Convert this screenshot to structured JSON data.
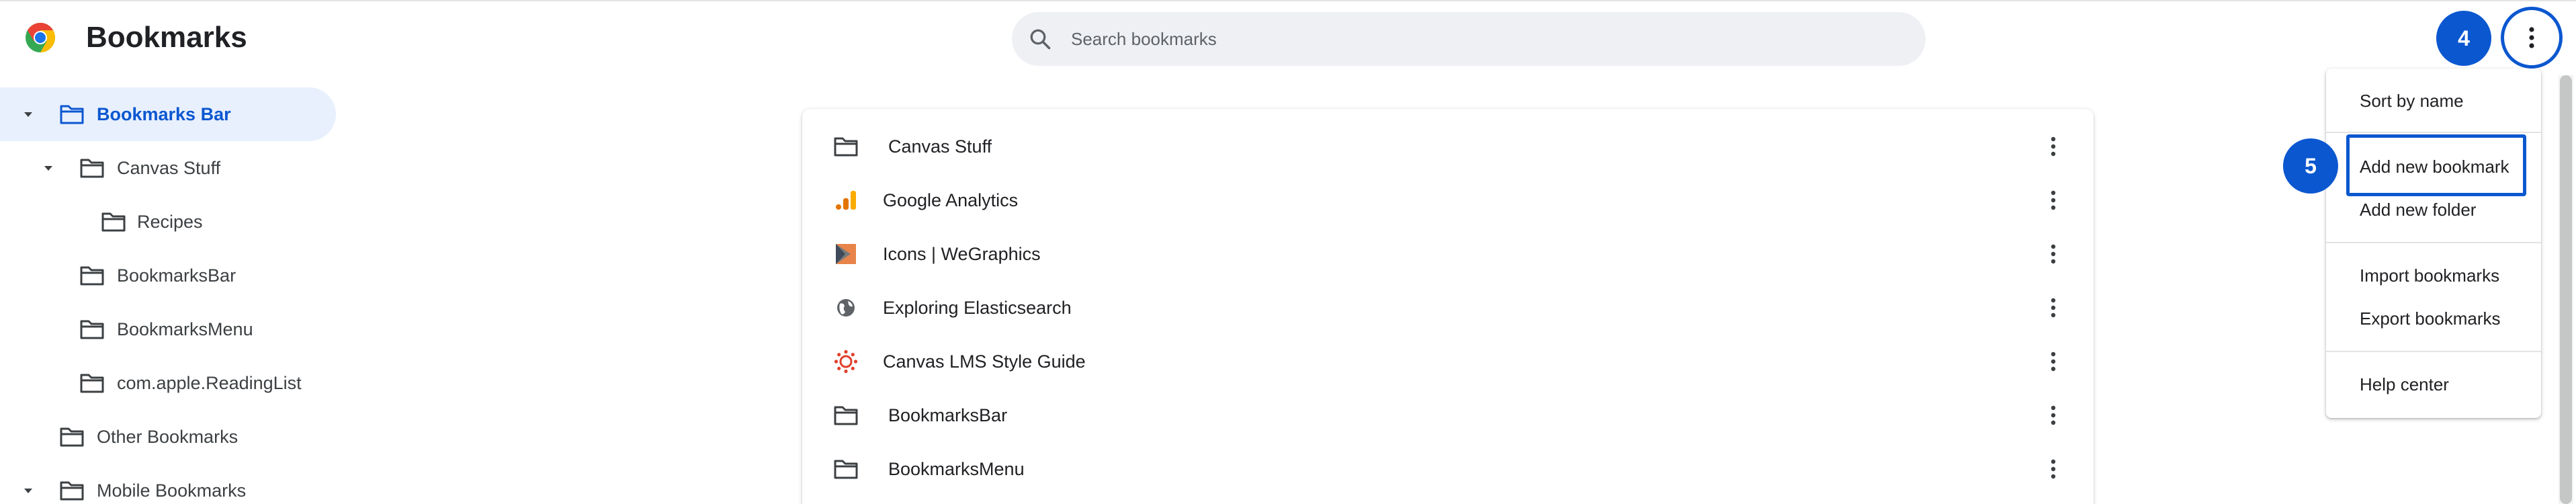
{
  "header": {
    "title": "Bookmarks",
    "search_placeholder": "Search bookmarks"
  },
  "annotations": {
    "badge_more": "4",
    "badge_add": "5"
  },
  "sidebar": {
    "items": [
      {
        "label": "Bookmarks Bar",
        "expanded": true,
        "selected": true
      },
      {
        "label": "Canvas Stuff",
        "expanded": true
      },
      {
        "label": "Recipes"
      },
      {
        "label": "BookmarksBar"
      },
      {
        "label": "BookmarksMenu"
      },
      {
        "label": "com.apple.ReadingList"
      },
      {
        "label": "Other Bookmarks"
      },
      {
        "label": "Mobile Bookmarks",
        "expanded": true
      }
    ]
  },
  "list": {
    "rows": [
      {
        "label": "Canvas Stuff",
        "icon": "folder-icon"
      },
      {
        "label": "Google Analytics",
        "icon": "google-analytics-favicon"
      },
      {
        "label": "Icons | WeGraphics",
        "icon": "wegraphics-favicon"
      },
      {
        "label": "Exploring Elasticsearch",
        "icon": "globe-icon"
      },
      {
        "label": "Canvas LMS Style Guide",
        "icon": "canvas-favicon"
      },
      {
        "label": "BookmarksBar",
        "icon": "folder-icon"
      },
      {
        "label": "BookmarksMenu",
        "icon": "folder-icon"
      }
    ]
  },
  "menu": {
    "items": [
      "Sort by name",
      "Add new bookmark",
      "Add new folder",
      "Import bookmarks",
      "Export bookmarks",
      "Help center"
    ]
  },
  "colors": {
    "accent": "#0b57d0",
    "selected_bg": "#e8f0fe",
    "search_bg": "#eef0f3"
  }
}
